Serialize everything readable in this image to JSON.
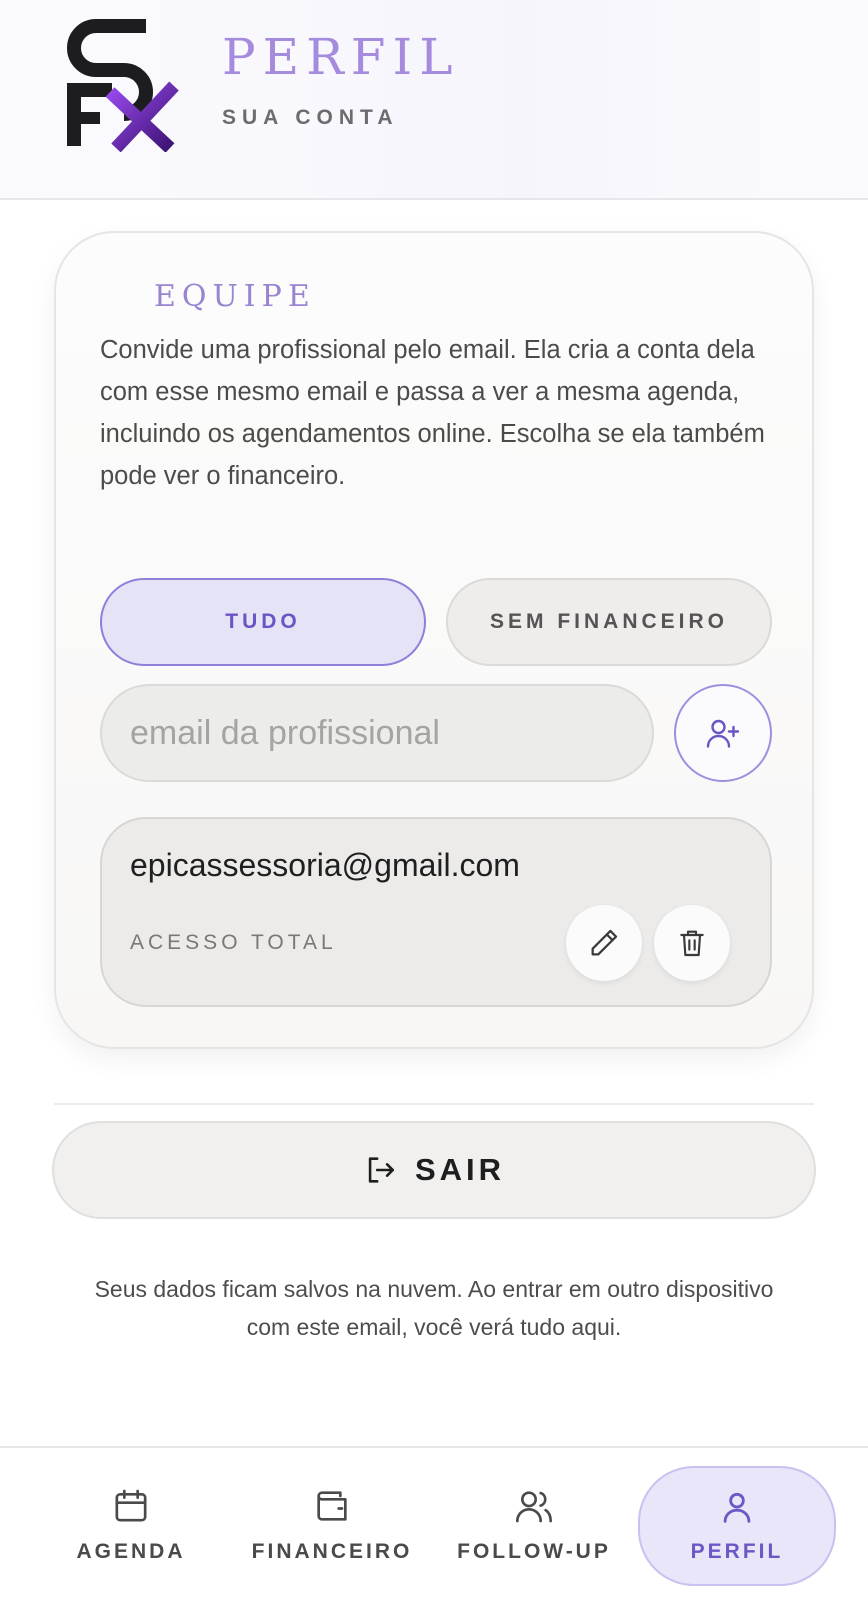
{
  "header": {
    "title": "PERFIL",
    "subtitle": "SUA CONTA",
    "logo_text": "SFX",
    "logo_icon": "sfx-logo"
  },
  "team_card": {
    "title": "EQUIPE",
    "description": "Convide uma profissional pelo email. Ela cria a conta dela com esse mesmo email e passa a ver a mesma agenda, incluindo os agendamentos online. Escolha se ela também pode ver o financeiro.",
    "permission_options": [
      {
        "label": "TUDO",
        "selected": true
      },
      {
        "label": "SEM FINANCEIRO",
        "selected": false
      }
    ],
    "email_input": {
      "placeholder": "email da profissional",
      "value": ""
    },
    "add_button_icon": "user-plus-icon",
    "members": [
      {
        "email": "epicassessoria@gmail.com",
        "access": "ACESSO TOTAL",
        "edit_icon": "pencil-icon",
        "delete_icon": "trash-icon"
      }
    ]
  },
  "logout": {
    "label": "SAIR",
    "icon": "logout-icon"
  },
  "footnote": "Seus dados ficam salvos na nuvem. Ao entrar em outro dispositivo com este email, você verá tudo aqui.",
  "bottom_nav": [
    {
      "label": "AGENDA",
      "icon": "calendar-icon",
      "active": false
    },
    {
      "label": "FINANCEIRO",
      "icon": "wallet-icon",
      "active": false
    },
    {
      "label": "FOLLOW-UP",
      "icon": "users-icon",
      "active": false
    },
    {
      "label": "PERFIL",
      "icon": "user-icon",
      "active": true
    }
  ],
  "colors": {
    "accent": "#8e7fdb",
    "accent_text": "#6b55c4",
    "title_purple": "#a58bde",
    "active_bg": "#e5e3f6"
  }
}
